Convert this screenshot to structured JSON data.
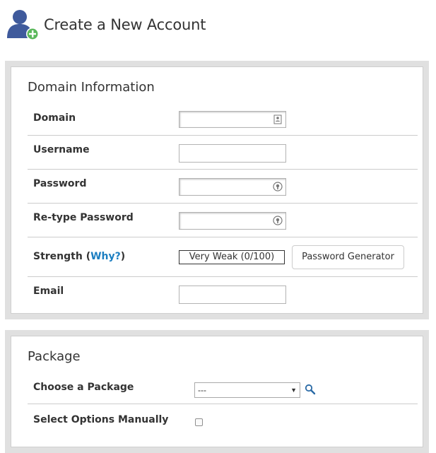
{
  "header": {
    "title": "Create a New Account",
    "icon": "add-user-icon"
  },
  "domain_section": {
    "title": "Domain Information",
    "fields": {
      "domain": {
        "label": "Domain",
        "value": ""
      },
      "username": {
        "label": "Username",
        "value": ""
      },
      "password": {
        "label": "Password",
        "value": ""
      },
      "retype": {
        "label": "Re-type Password",
        "value": ""
      },
      "strength": {
        "label_prefix": "Strength (",
        "why": "Why?",
        "label_suffix": ")",
        "meter": "Very Weak (0/100)",
        "generator_label": "Password Generator"
      },
      "email": {
        "label": "Email",
        "value": ""
      }
    }
  },
  "package_section": {
    "title": "Package",
    "choose_label": "Choose a Package",
    "selected": "---",
    "manual_label": "Select Options Manually",
    "manual_checked": false
  },
  "colors": {
    "link": "#1b7ec1",
    "avatar": "#3f5a9c",
    "plus": "#5cb85c",
    "panel_bg": "#e0e0e0"
  }
}
